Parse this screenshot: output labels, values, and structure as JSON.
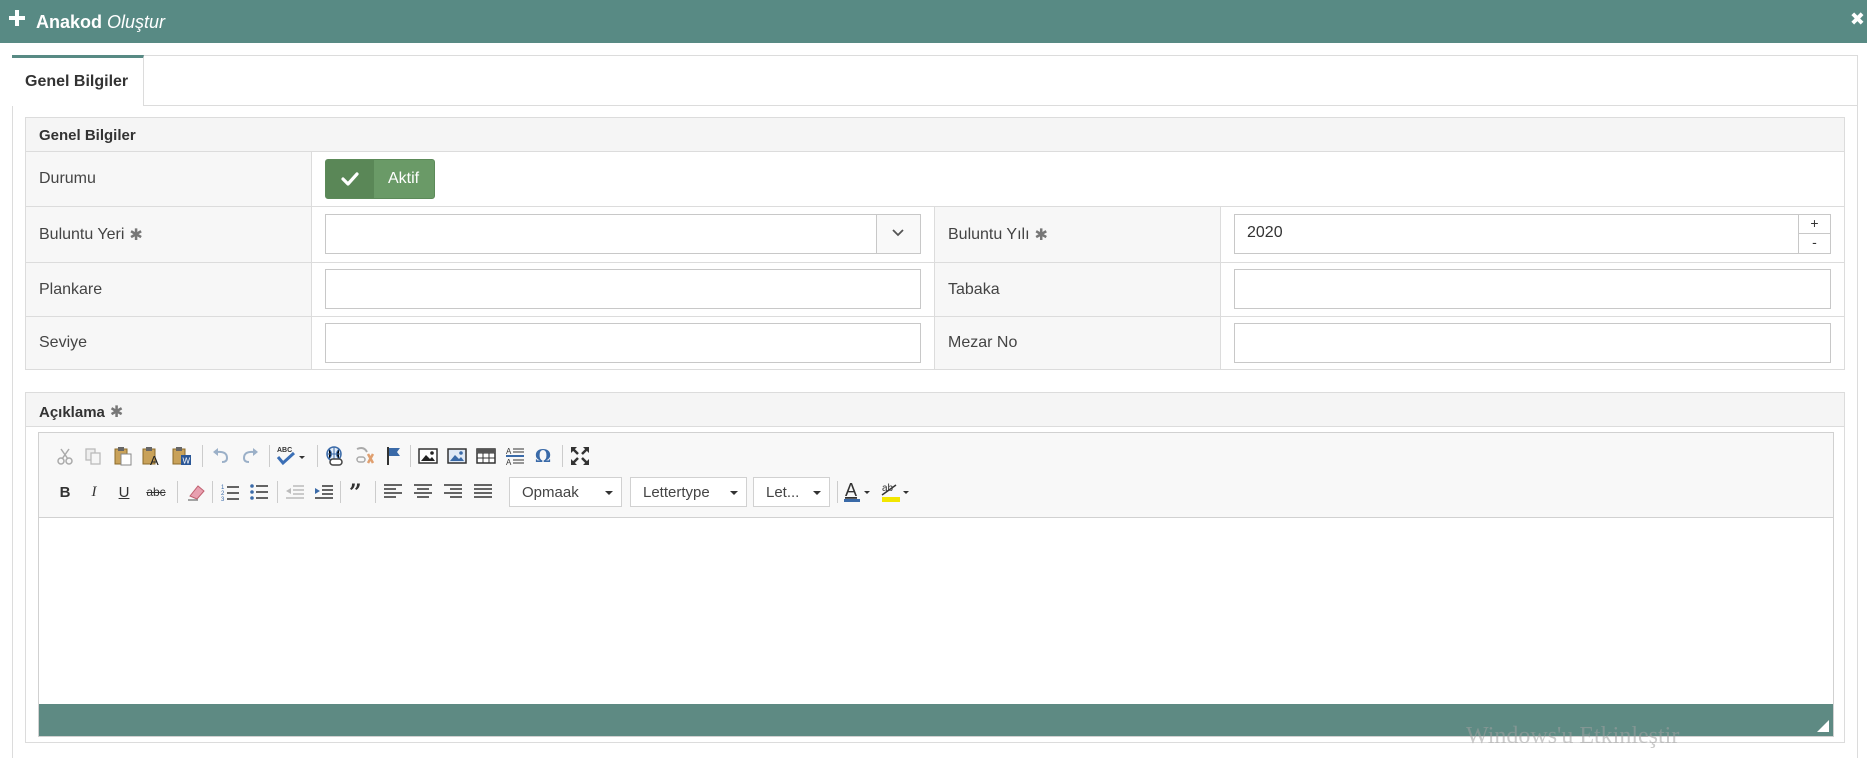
{
  "window": {
    "title_bold": "Anakod",
    "title_italic": "Oluştur",
    "close_glyph": "✖"
  },
  "tabs": [
    {
      "label": "Genel Bilgiler",
      "active": true
    }
  ],
  "section": {
    "title": "Genel Bilgiler",
    "durumu_label": "Durumu",
    "toggle_label": "Aktif",
    "toggle_on": true,
    "buluntu_yeri_label": "Buluntu Yeri",
    "buluntu_yeri_value": "",
    "buluntu_yili_label": "Buluntu Yılı",
    "buluntu_yili_value": "2020",
    "spin_up": "+",
    "spin_down": "-",
    "plankare_label": "Plankare",
    "tabaka_label": "Tabaka",
    "seviye_label": "Seviye",
    "mezar_no_label": "Mezar No",
    "required_mark": "✱"
  },
  "aciklama": {
    "label": "Açıklama",
    "format_combo": "Opmaak",
    "font_combo": "Lettertype",
    "size_combo": "Let...",
    "bold": "B",
    "italic": "I",
    "underline": "U",
    "strike": "abc",
    "spell": "ABC",
    "text_color": "A",
    "bg_color": "ab"
  },
  "colors": {
    "header": "#588a84",
    "toggle": "#6a9a67",
    "editor_bottom": "#5e8a83"
  },
  "watermark": "Windows'u Etkinleştir"
}
